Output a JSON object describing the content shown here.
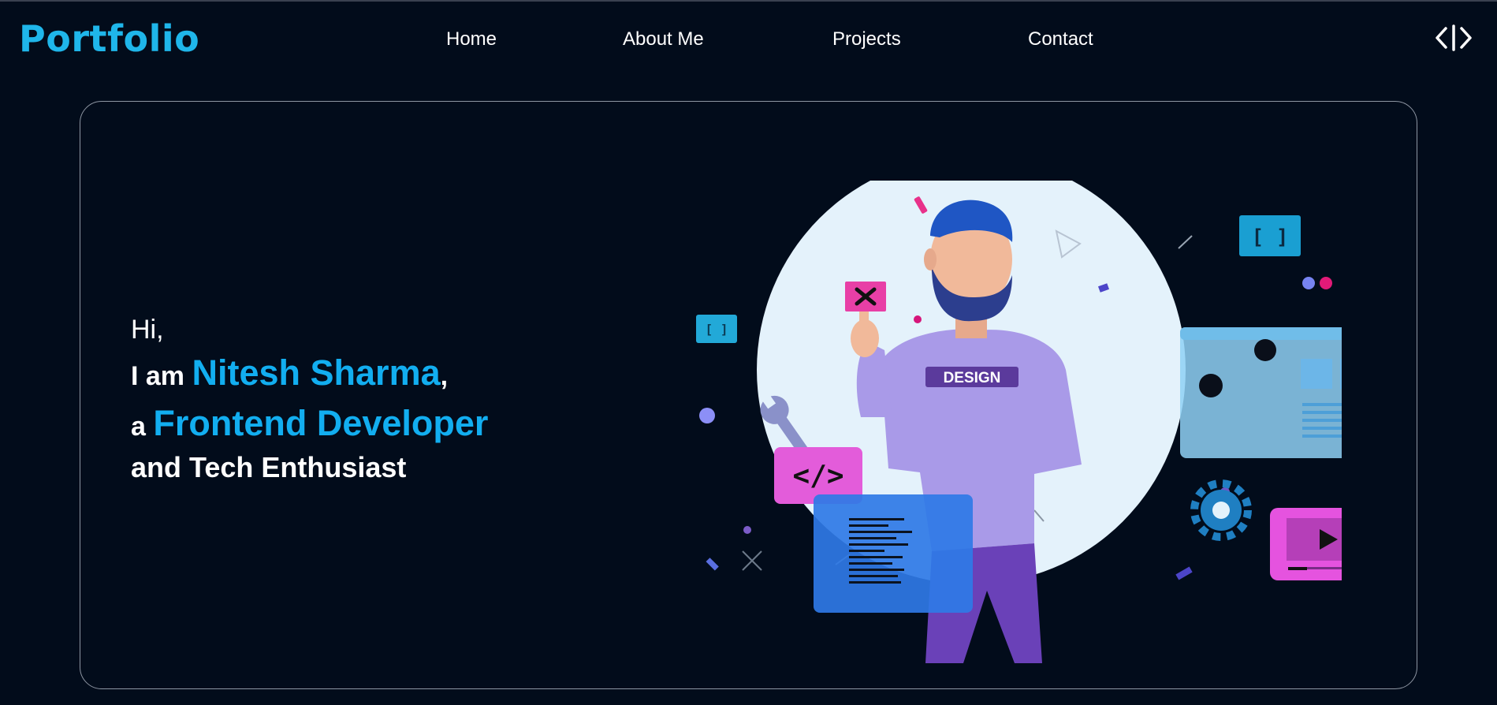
{
  "header": {
    "logo": "Portfolio",
    "nav": [
      {
        "label": "Home"
      },
      {
        "label": "About Me"
      },
      {
        "label": "Projects"
      },
      {
        "label": "Contact"
      }
    ],
    "toggle_icon": "code-brackets-icon"
  },
  "hero": {
    "greeting": "Hi,",
    "name_prefix": "I am",
    "name": "Nitesh Sharma",
    "name_suffix": ",",
    "role_prefix": "a",
    "role": "Frontend Developer",
    "tagline": "and Tech Enthusiast",
    "illustration": {
      "shirt_text": "DESIGN",
      "code_tag": "</>",
      "bracket_tag": "[ ]"
    }
  },
  "colors": {
    "background": "#020c1b",
    "accent": "#12aef0",
    "logo": "#1fb6ea",
    "border": "#8e96a3"
  }
}
